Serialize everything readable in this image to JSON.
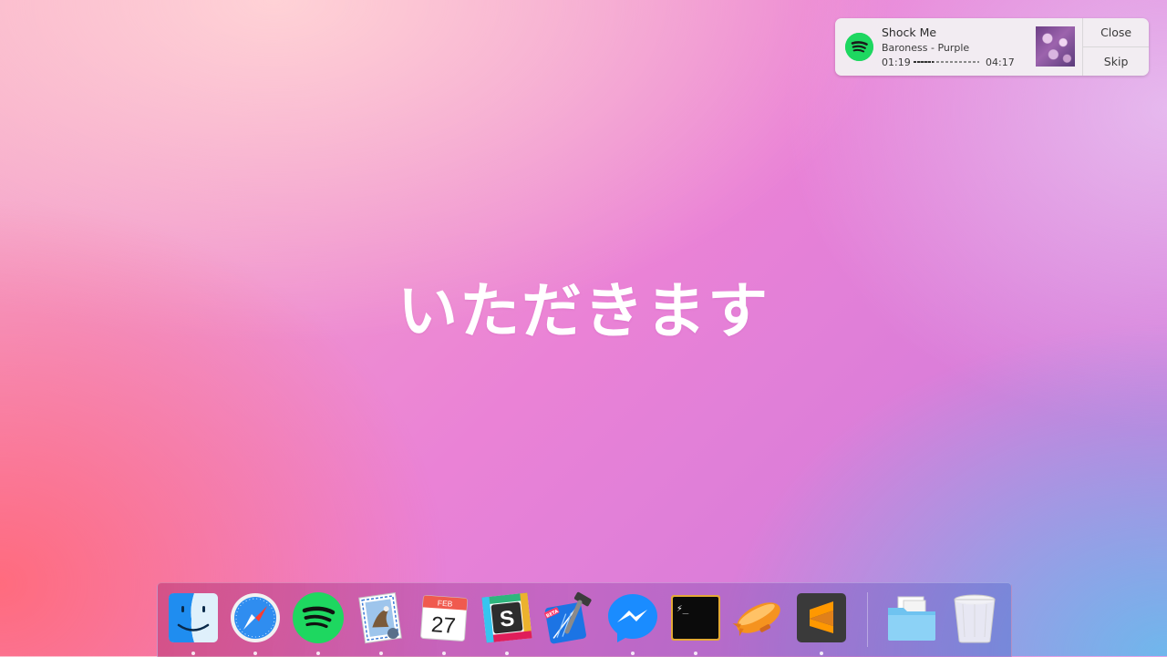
{
  "notification": {
    "title": "Shock Me",
    "subtitle": "Baroness - Purple",
    "elapsed": "01:19",
    "total": "04:17",
    "progress_fraction": 0.31,
    "app_icon": "spotify-icon",
    "close_label": "Close",
    "skip_label": "Skip"
  },
  "desktop": {
    "center_text": "いただきます"
  },
  "dock": {
    "apps": [
      {
        "name": "Finder",
        "icon": "finder-icon",
        "running": true
      },
      {
        "name": "Safari",
        "icon": "safari-icon",
        "running": true
      },
      {
        "name": "Spotify",
        "icon": "spotify-icon",
        "running": true
      },
      {
        "name": "Mail",
        "icon": "mail-icon",
        "running": true
      },
      {
        "name": "Calendar",
        "icon": "calendar-icon",
        "running": true,
        "month": "FEB",
        "day": "27"
      },
      {
        "name": "Slack",
        "icon": "slack-icon",
        "running": true
      },
      {
        "name": "Xcode Beta",
        "icon": "xcode-icon",
        "running": false,
        "badge": "BETA"
      },
      {
        "name": "Messenger",
        "icon": "messenger-icon",
        "running": true
      },
      {
        "name": "Terminal",
        "icon": "terminal-icon",
        "running": true,
        "prompt": "⚡_"
      },
      {
        "name": "Airmail",
        "icon": "zeppelin-icon",
        "running": false
      },
      {
        "name": "Sublime Text",
        "icon": "sublime-icon",
        "running": true
      }
    ],
    "stack": [
      {
        "name": "Documents",
        "icon": "folder-icon",
        "running": false
      },
      {
        "name": "Trash",
        "icon": "trash-icon",
        "running": false
      }
    ],
    "colors": {
      "spotify_green": "#1ed760",
      "safari_blue": "#2f8df0",
      "messenger_blue": "#1a8cff",
      "sublime_orange": "#ff9800"
    }
  }
}
